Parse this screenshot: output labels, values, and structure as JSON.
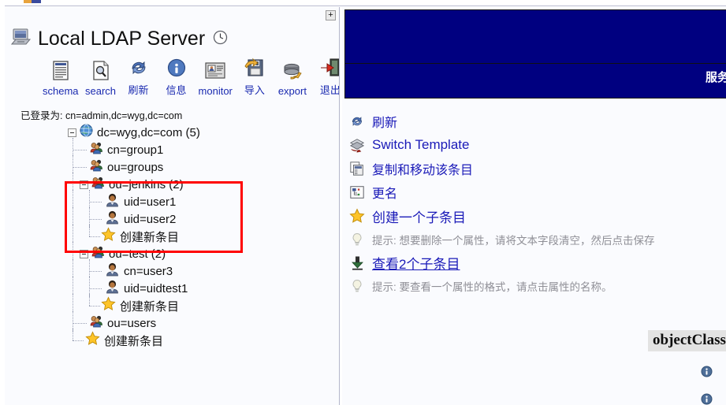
{
  "window": {
    "background_color": "#fafbfe",
    "divider_color": "#b3b6cb"
  },
  "left_panel": {
    "expand_button_label": "+",
    "server": {
      "icon": "computer-icon",
      "title": "Local LDAP Server",
      "clock_icon": "clock-icon"
    },
    "toolbar": [
      {
        "icon": "schema-document-icon",
        "label": "schema"
      },
      {
        "icon": "search-document-icon",
        "label": "search"
      },
      {
        "icon": "refresh-arrows-icon",
        "label": "刷新"
      },
      {
        "icon": "info-circle-icon",
        "label": "信息"
      },
      {
        "icon": "monitor-card-icon",
        "label": "monitor"
      },
      {
        "icon": "import-floppy-icon",
        "label": "导入"
      },
      {
        "icon": "export-database-icon",
        "label": "export"
      },
      {
        "icon": "logout-door-icon",
        "label": "退出"
      }
    ],
    "logged_in": "已登录为: cn=admin,dc=wyg,dc=com",
    "tree": [
      {
        "level": 0,
        "toggle": "minus",
        "icon": "globe-icon",
        "label": "dc=wyg,dc=com (5)"
      },
      {
        "level": 1,
        "toggle": "none",
        "icon": "group-icon",
        "label": "cn=group1"
      },
      {
        "level": 1,
        "toggle": "none",
        "icon": "group-icon",
        "label": "ou=groups"
      },
      {
        "level": 1,
        "toggle": "minus",
        "icon": "group-icon",
        "label": "ou=jenkins (2)"
      },
      {
        "level": 2,
        "toggle": "none",
        "icon": "user-icon",
        "label": "uid=user1"
      },
      {
        "level": 2,
        "toggle": "none",
        "icon": "user-icon",
        "label": "uid=user2"
      },
      {
        "level": 2,
        "toggle": "none",
        "icon": "star-icon",
        "label": "创建新条目"
      },
      {
        "level": 1,
        "toggle": "minus",
        "icon": "group-icon",
        "label": "ou=test (2)"
      },
      {
        "level": 2,
        "toggle": "none",
        "icon": "user-icon",
        "label": "cn=user3"
      },
      {
        "level": 2,
        "toggle": "none",
        "icon": "user-icon",
        "label": "uid=uidtest1"
      },
      {
        "level": 2,
        "toggle": "none",
        "icon": "star-icon",
        "label": "创建新条目"
      },
      {
        "level": 1,
        "toggle": "none",
        "icon": "group-icon",
        "label": "ou=users"
      },
      {
        "level": 1,
        "toggle": "none",
        "icon": "star-icon",
        "label": "创建新条目"
      }
    ],
    "annotation": {
      "shape": "rectangle",
      "color": "#ff0000",
      "highlights": [
        "ou=jenkins (2)",
        "uid=user1",
        "uid=user2"
      ]
    }
  },
  "right_panel": {
    "header": {
      "background_color": "#000080",
      "text": "服务器"
    },
    "menu": [
      {
        "icon": "refresh-arrows-icon",
        "label": "刷新",
        "type": "link",
        "underline": false
      },
      {
        "icon": "switch-template-icon",
        "label": "Switch Template",
        "type": "link",
        "underline": false
      },
      {
        "icon": "copy-move-icon",
        "label": "复制和移动该条目",
        "type": "link",
        "underline": false
      },
      {
        "icon": "rename-icon",
        "label": "更名",
        "type": "link",
        "underline": false
      },
      {
        "icon": "star-icon",
        "label": "创建一个子条目",
        "type": "link",
        "underline": false
      },
      {
        "icon": "lightbulb-icon",
        "label": "提示:  想要删除一个属性，请将文本字段清空，然后点击保存",
        "type": "hint",
        "underline": false
      },
      {
        "icon": "download-arrow-icon",
        "label": "查看2个子条目",
        "type": "link",
        "underline": true
      },
      {
        "icon": "lightbulb-icon",
        "label": "提示:  要查看一个属性的格式，请点击属性的名称。",
        "type": "hint",
        "underline": false
      }
    ],
    "attribute_table": {
      "header": "objectClass",
      "header_background": "#e3e3e3",
      "info_icons": [
        "info-circle-icon",
        "info-circle-icon"
      ]
    }
  }
}
